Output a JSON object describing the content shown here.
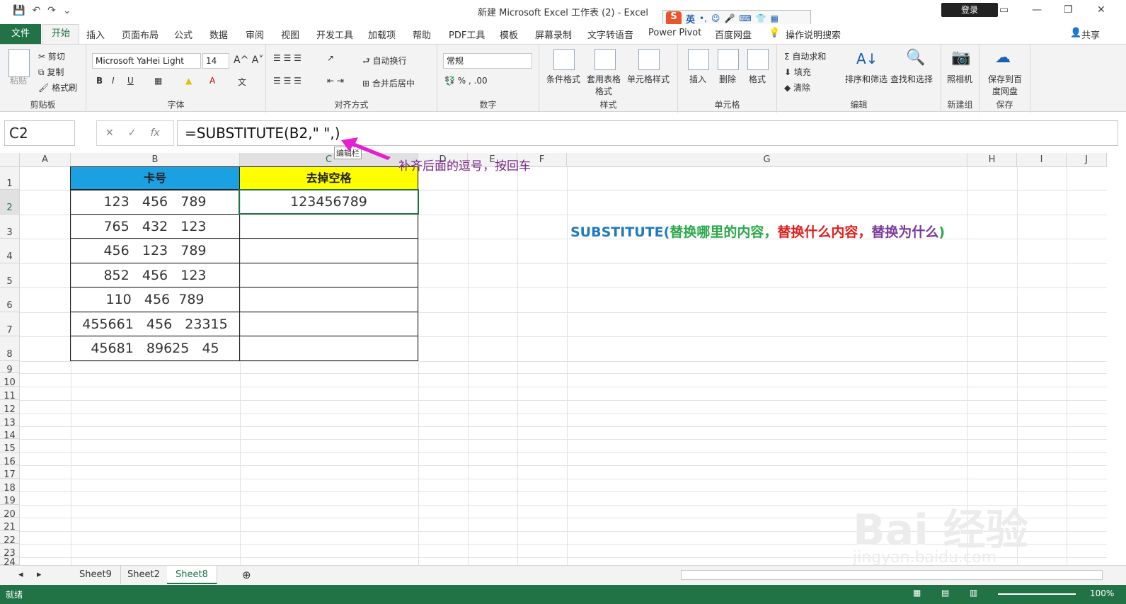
{
  "window": {
    "title": "新建 Microsoft Excel 工作表 (2)  -  Excel",
    "login": "登录"
  },
  "ime": {
    "lang": "英"
  },
  "ribbon_tabs": [
    "文件",
    "开始",
    "插入",
    "页面布局",
    "公式",
    "数据",
    "审阅",
    "视图",
    "开发工具",
    "加载项",
    "帮助",
    "PDF工具",
    "模板",
    "屏幕录制",
    "文字转语音",
    "Power Pivot",
    "百度网盘",
    "操作说明搜索"
  ],
  "share": "共享",
  "clipboard": {
    "paste": "粘贴",
    "cut": "剪切",
    "copy": "复制",
    "painter": "格式刷",
    "label": "剪贴板"
  },
  "font": {
    "name": "Microsoft YaHei Light",
    "size": "14",
    "label": "字体"
  },
  "align": {
    "wrap": "自动换行",
    "merge": "合并后居中",
    "label": "对齐方式"
  },
  "number": {
    "format": "常规",
    "label": "数字"
  },
  "styles": {
    "cond": "条件格式",
    "table": "套用表格格式",
    "cell": "单元格样式",
    "label": "样式"
  },
  "cells": {
    "insert": "插入",
    "delete": "删除",
    "format": "格式",
    "label": "单元格"
  },
  "editing": {
    "autosum": "自动求和",
    "fill": "填充",
    "clear": "清除",
    "sort": "排序和筛选",
    "find": "查找和选择",
    "label": "编辑"
  },
  "newgrp": {
    "camera": "照相机",
    "label": "新建组"
  },
  "save": {
    "baidu": "保存到百度网盘",
    "label": "保存"
  },
  "namebox": "C2",
  "formula": "=SUBSTITUTE(B2,\" \",)",
  "tooltip": "编辑栏",
  "annotation": "补齐后面的逗号，按回车",
  "columns": [
    "A",
    "B",
    "C",
    "D",
    "E",
    "F",
    "G",
    "H",
    "I",
    "J"
  ],
  "rows": [
    "1",
    "2",
    "3",
    "4",
    "5",
    "6",
    "7",
    "8",
    "9",
    "10",
    "11",
    "12",
    "13",
    "14",
    "15",
    "16",
    "17",
    "18",
    "19",
    "20",
    "21",
    "22",
    "23",
    "24"
  ],
  "table": {
    "header_b": "卡号",
    "header_c": "去掉空格",
    "b_values": [
      "123   456   789",
      "765   432   123",
      "456   123   789",
      "852   456   123",
      "110   456  789",
      "455661   456   23315",
      "45681   89625   45"
    ],
    "c_values": [
      "123456789",
      "",
      "",
      "",
      "",
      "",
      ""
    ]
  },
  "syntax": {
    "fn": "SUBSTITUTE(",
    "p1": "替换哪里的内容，",
    "p2": "替换什么内容，",
    "p3": "替换为什么",
    "close": ")"
  },
  "syntax_colors": {
    "fn": "#1f7ac0",
    "p1": "#2aa84a",
    "p2": "#e0201c",
    "p3": "#7a3a9a"
  },
  "sheets": [
    "Sheet9",
    "Sheet2",
    "Sheet8"
  ],
  "status": {
    "ready": "就绪",
    "zoom": "100%"
  },
  "watermark": {
    "brand": "Bai 经验",
    "url": "jingyan.baidu.com"
  }
}
